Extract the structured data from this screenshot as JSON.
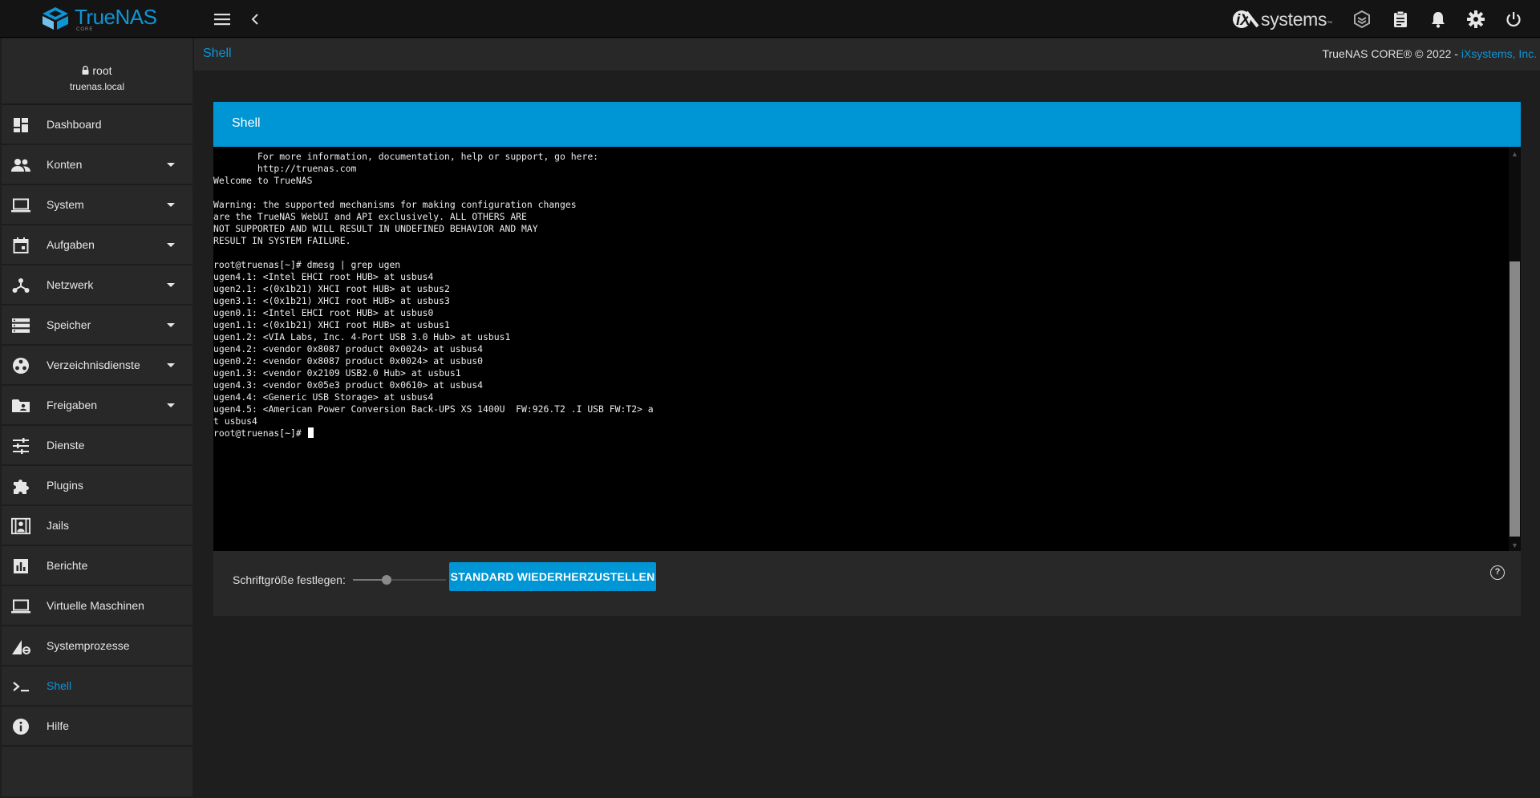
{
  "app": {
    "logo_text": "TrueNAS",
    "logo_subtext": "CORE",
    "brand_right": "systems",
    "brand_right_prefix": "iX",
    "brand_tm": "™"
  },
  "colors": {
    "accent": "#0095d5",
    "topbar": "#141414",
    "panel": "#282828",
    "background": "#1e1e1e",
    "terminal_bg": "#000000"
  },
  "topbar": {
    "menu_icon": "menu-icon",
    "back_icon": "chevron-left-icon",
    "right_icons": [
      "truecommand-icon",
      "clipboard-icon",
      "bell-icon",
      "gear-icon",
      "power-icon"
    ]
  },
  "breadcrumb": {
    "current": "Shell"
  },
  "copyright": {
    "text": "TrueNAS CORE® © 2022 - ",
    "company": "iXsystems, Inc."
  },
  "user": {
    "name": "root",
    "host": "truenas.local",
    "icon": "lock-icon"
  },
  "sidebar": {
    "items": [
      {
        "label": "Dashboard",
        "icon": "dashboard-icon",
        "has_submenu": false
      },
      {
        "label": "Konten",
        "icon": "people-icon",
        "has_submenu": true
      },
      {
        "label": "System",
        "icon": "laptop-icon",
        "has_submenu": true
      },
      {
        "label": "Aufgaben",
        "icon": "calendar-icon",
        "has_submenu": true
      },
      {
        "label": "Netzwerk",
        "icon": "network-icon",
        "has_submenu": true
      },
      {
        "label": "Speicher",
        "icon": "storage-icon",
        "has_submenu": true
      },
      {
        "label": "Verzeichnisdienste",
        "icon": "directory-icon",
        "has_submenu": true
      },
      {
        "label": "Freigaben",
        "icon": "folder-shared-icon",
        "has_submenu": true
      },
      {
        "label": "Dienste",
        "icon": "tune-icon",
        "has_submenu": false
      },
      {
        "label": "Plugins",
        "icon": "puzzle-icon",
        "has_submenu": false
      },
      {
        "label": "Jails",
        "icon": "jail-icon",
        "has_submenu": false
      },
      {
        "label": "Berichte",
        "icon": "bar-chart-icon",
        "has_submenu": false
      },
      {
        "label": "Virtuelle Maschinen",
        "icon": "computer-icon",
        "has_submenu": false
      },
      {
        "label": "Systemprozesse",
        "icon": "processes-icon",
        "has_submenu": false
      },
      {
        "label": "Shell",
        "icon": "terminal-icon",
        "has_submenu": false,
        "active": true
      },
      {
        "label": "Hilfe",
        "icon": "info-icon",
        "has_submenu": false
      }
    ]
  },
  "shell": {
    "title": "Shell",
    "lines": [
      "        For more information, documentation, help or support, go here:",
      "        http://truenas.com",
      "Welcome to TrueNAS",
      "",
      "Warning: the supported mechanisms for making configuration changes",
      "are the TrueNAS WebUI and API exclusively. ALL OTHERS ARE",
      "NOT SUPPORTED AND WILL RESULT IN UNDEFINED BEHAVIOR AND MAY",
      "RESULT IN SYSTEM FAILURE.",
      "",
      "root@truenas[~]# dmesg | grep ugen",
      "ugen4.1: <Intel EHCI root HUB> at usbus4",
      "ugen2.1: <(0x1b21) XHCI root HUB> at usbus2",
      "ugen3.1: <(0x1b21) XHCI root HUB> at usbus3",
      "ugen0.1: <Intel EHCI root HUB> at usbus0",
      "ugen1.1: <(0x1b21) XHCI root HUB> at usbus1",
      "ugen1.2: <VIA Labs, Inc. 4-Port USB 3.0 Hub> at usbus1",
      "ugen4.2: <vendor 0x8087 product 0x0024> at usbus4",
      "ugen0.2: <vendor 0x8087 product 0x0024> at usbus0",
      "ugen1.3: <vendor 0x2109 USB2.0 Hub> at usbus1",
      "ugen4.3: <vendor 0x05e3 product 0x0610> at usbus4",
      "ugen4.4: <Generic USB Storage> at usbus4",
      "ugen4.5: <American Power Conversion Back-UPS XS 1400U  FW:926.T2 .I USB FW:T2> a",
      "t usbus4"
    ],
    "prompt": "root@truenas[~]#",
    "scroll_position": 0.55
  },
  "controls": {
    "font_size_label": "Schriftgröße festlegen:",
    "font_size_level": 0.36,
    "reset_button": "STANDARD WIEDERHERZUSTELLEN",
    "help_icon": "help-circle-icon",
    "help_glyph": "?"
  }
}
